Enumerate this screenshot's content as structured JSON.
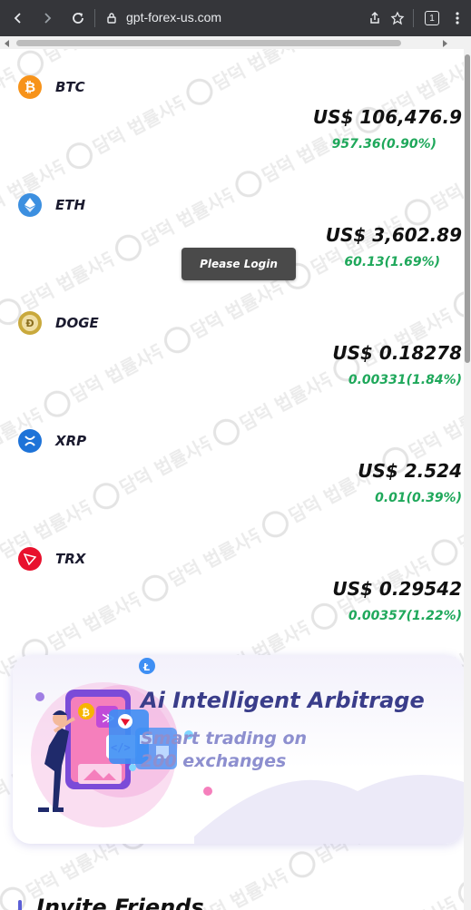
{
  "browser": {
    "url": "gpt-forex-us.com",
    "tab_count": "1",
    "icons": [
      "back-icon",
      "forward-icon",
      "reload-icon",
      "site-info-icon",
      "share-icon",
      "bookmark-icon",
      "tab-count-icon",
      "menu-icon"
    ]
  },
  "coins": [
    {
      "symbol": "BTC",
      "price": "US$ 106,476.9",
      "change": "957.36(0.90%)",
      "icon": "bitcoin-icon",
      "color": "#f7931a",
      "glyph": "₿"
    },
    {
      "symbol": "ETH",
      "price": "US$ 3,602.89",
      "change": "60.13(1.69%)",
      "icon": "ethereum-icon",
      "color": "#3c8fe0",
      "glyph": "◆"
    },
    {
      "symbol": "DOGE",
      "price": "US$ 0.18278",
      "change": "0.00331(1.84%)",
      "icon": "dogecoin-icon",
      "color": "#c9a93c",
      "glyph": "Ð"
    },
    {
      "symbol": "XRP",
      "price": "US$ 2.524",
      "change": "0.01(0.39%)",
      "icon": "xrp-icon",
      "color": "#1e73d8",
      "glyph": "✕"
    },
    {
      "symbol": "TRX",
      "price": "US$ 0.29542",
      "change": "0.00357(1.22%)",
      "icon": "tron-icon",
      "color": "#e8112d",
      "glyph": "▼"
    }
  ],
  "toast": {
    "text": "Please Login"
  },
  "banner": {
    "title": "Ai Intelligent Arbitrage",
    "subtitle": "Smart trading on 200 exchanges"
  },
  "section": {
    "title": "Invite Friends"
  },
  "colors": {
    "positive": "#1fa85b",
    "accent": "#3a3d8a",
    "toolbar": "#35363a"
  }
}
